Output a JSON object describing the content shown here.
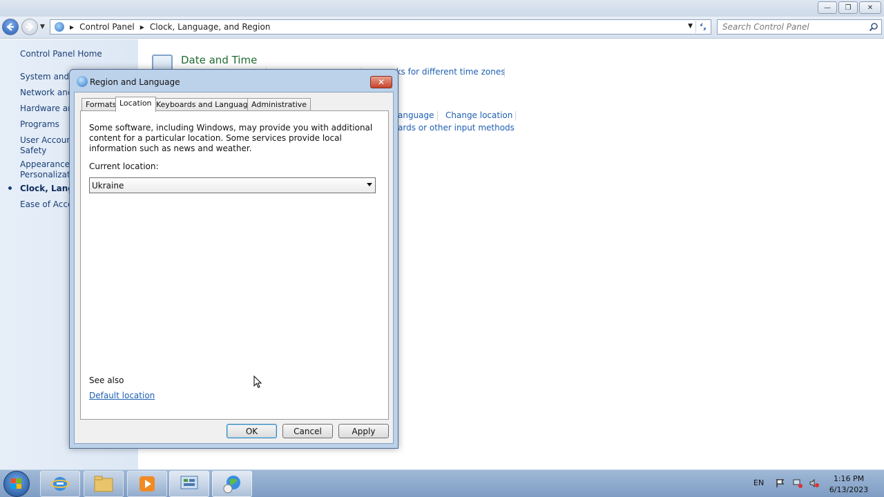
{
  "window": {
    "controls": {
      "minimize": "—",
      "restore": "❐",
      "close": "✕"
    }
  },
  "address_bar": {
    "crumbs": [
      "Control Panel",
      "Clock, Language, and Region"
    ],
    "search_placeholder": "Search Control Panel"
  },
  "left_nav": {
    "home": "Control Panel Home",
    "items": [
      "System and S",
      "Network and",
      "Hardware and",
      "Programs",
      "User Account",
      "Safety",
      "Appearance a",
      "Personalizatio",
      "Clock, Langua",
      "Ease of Acces"
    ]
  },
  "main": {
    "category_title": "Date and Time",
    "links": {
      "time_zones": "cks for different time zones",
      "language": "anguage",
      "change_location": "Change location",
      "input_methods": "ards or other input methods"
    }
  },
  "dialog": {
    "title": "Region and Language",
    "close": "✕",
    "tabs": [
      "Formats",
      "Location",
      "Keyboards and Languages",
      "Administrative"
    ],
    "selected_tab": "Location",
    "description": "Some software, including Windows, may provide you with additional content for a particular location. Some services provide local information such as news and weather.",
    "current_location_label": "Current location:",
    "current_location_value": "Ukraine",
    "see_also": "See also",
    "default_location_link": "Default location",
    "buttons": {
      "ok": "OK",
      "cancel": "Cancel",
      "apply": "Apply"
    }
  },
  "taskbar": {
    "language": "EN",
    "time": "1:16 PM",
    "date": "6/13/2023"
  }
}
